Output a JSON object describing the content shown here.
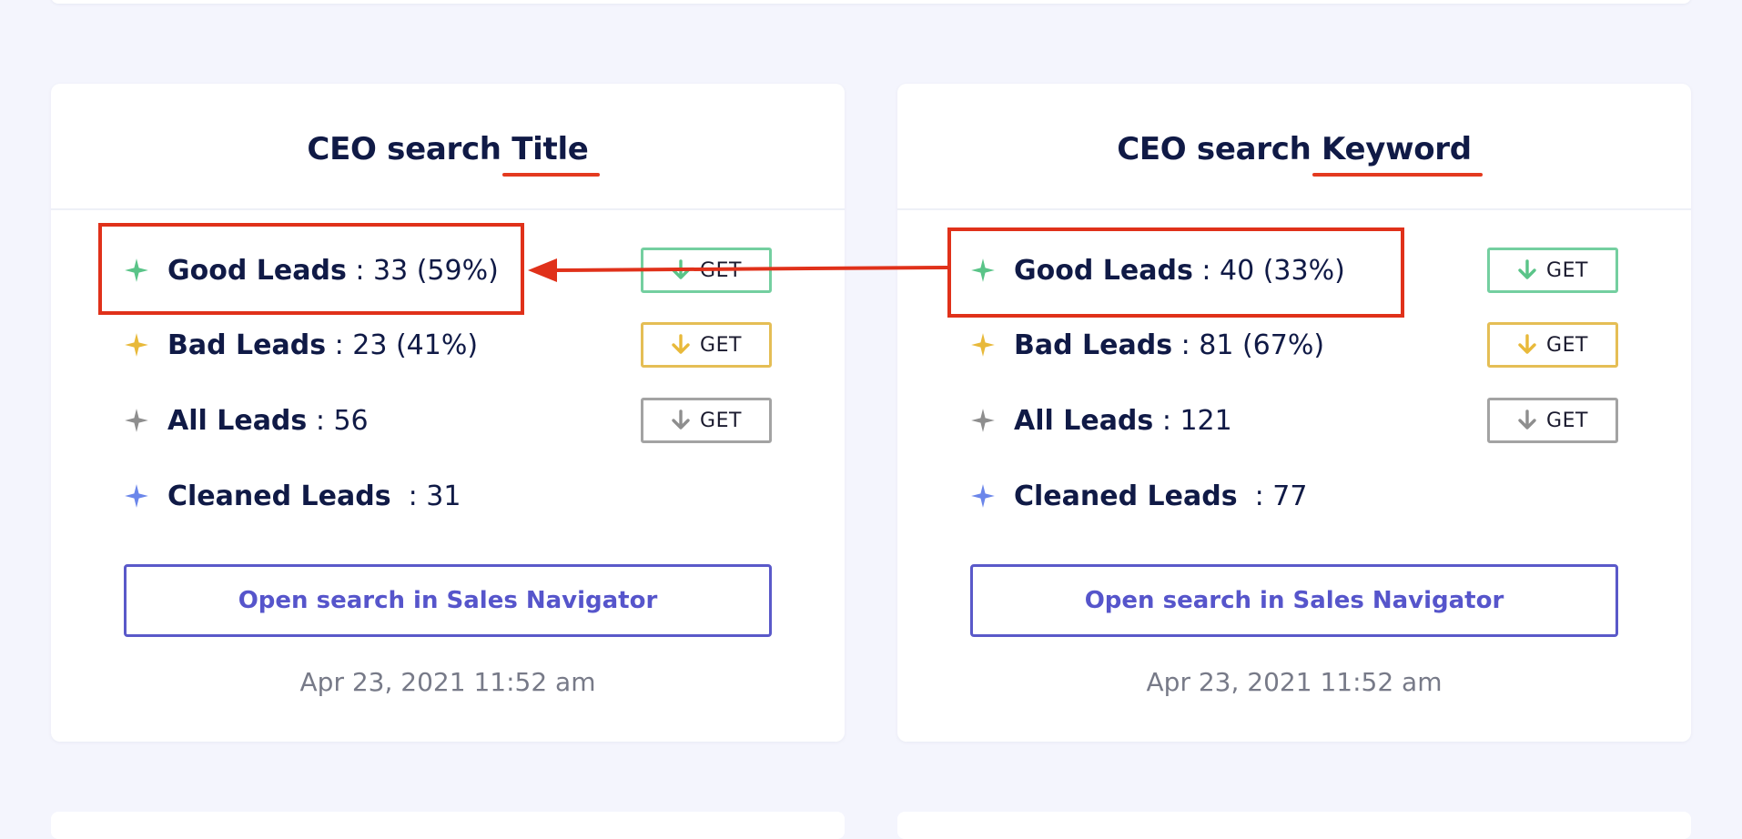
{
  "cards": [
    {
      "title_prefix": "CEO search ",
      "title_highlight": "Title",
      "rows": [
        {
          "label": "Good Leads",
          "value": " : 33 (59%)",
          "button": "GET",
          "star_color": "#5ac488",
          "button_color": "#74cfa0",
          "icon": "star-icon"
        },
        {
          "label": "Bad Leads",
          "value": " : 23 (41%)",
          "button": "GET",
          "star_color": "#e8b93a",
          "button_color": "#e5be55",
          "icon": "star-icon"
        },
        {
          "label": "All Leads",
          "value": " : 56",
          "button": "GET",
          "star_color": "#8e8e8e",
          "button_color": "#a3a3a3",
          "icon": "star-icon"
        },
        {
          "label": "Cleaned Leads",
          "value": "  : 31",
          "star_color": "#6b86ea",
          "icon": "star-icon"
        }
      ],
      "open_button": "Open search in Sales Navigator",
      "timestamp": "Apr 23, 2021 11:52 am"
    },
    {
      "title_prefix": "CEO search ",
      "title_highlight": "Keyword",
      "rows": [
        {
          "label": "Good Leads",
          "value": " : 40 (33%)",
          "button": "GET",
          "star_color": "#5ac488",
          "button_color": "#74cfa0",
          "icon": "star-icon"
        },
        {
          "label": "Bad Leads",
          "value": " : 81 (67%)",
          "button": "GET",
          "star_color": "#e8b93a",
          "button_color": "#e5be55",
          "icon": "star-icon"
        },
        {
          "label": "All Leads",
          "value": " : 121",
          "button": "GET",
          "star_color": "#8e8e8e",
          "button_color": "#a3a3a3",
          "icon": "star-icon"
        },
        {
          "label": "Cleaned Leads",
          "value": "  : 77",
          "star_color": "#6b86ea",
          "icon": "star-icon"
        }
      ],
      "open_button": "Open search in Sales Navigator",
      "timestamp": "Apr 23, 2021 11:52 am"
    }
  ],
  "colors": {
    "annotation": "#e0311a",
    "accent": "#5655cb",
    "page_background": "#f4f5fd",
    "text": "#101a46"
  }
}
